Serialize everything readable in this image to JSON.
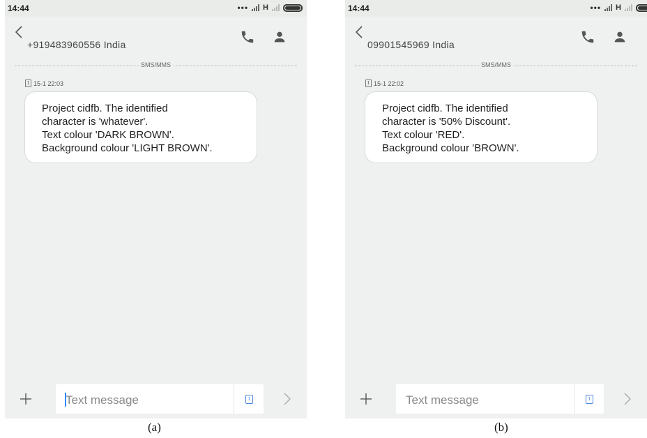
{
  "panels": [
    {
      "status": {
        "time": "14:44",
        "network": "H"
      },
      "header": {
        "contact": "+919483960556 India"
      },
      "channel_label": "SMS/MMS",
      "message": {
        "sim": "1",
        "timestamp": "15-1 22:03",
        "lines": [
          "Project cidfb. The identified",
          "character is 'whatever'.",
          "Text colour 'DARK BROWN'.",
          "Background colour 'LIGHT BROWN'."
        ]
      },
      "input": {
        "placeholder": "Text message",
        "sim": "1"
      },
      "caption": "(a)"
    },
    {
      "status": {
        "time": "14:44",
        "network": "H"
      },
      "header": {
        "contact": "09901545969 India"
      },
      "channel_label": "SMS/MMS",
      "message": {
        "sim": "1",
        "timestamp": "15-1 22:02",
        "lines": [
          "Project cidfb. The identified",
          "character is '50% Discount'.",
          "Text colour 'RED'.",
          "Background colour 'BROWN'."
        ]
      },
      "input": {
        "placeholder": "Text message",
        "sim": "1"
      },
      "caption": "(b)"
    }
  ],
  "colors": {
    "background": "#eef1ef",
    "bubble": "#ffffff",
    "accent": "#4a86e0",
    "icon": "#555555"
  },
  "icons": [
    "back-arrow-icon",
    "phone-icon",
    "person-icon",
    "plus-icon",
    "sim-card-icon",
    "send-chevron-icon"
  ]
}
